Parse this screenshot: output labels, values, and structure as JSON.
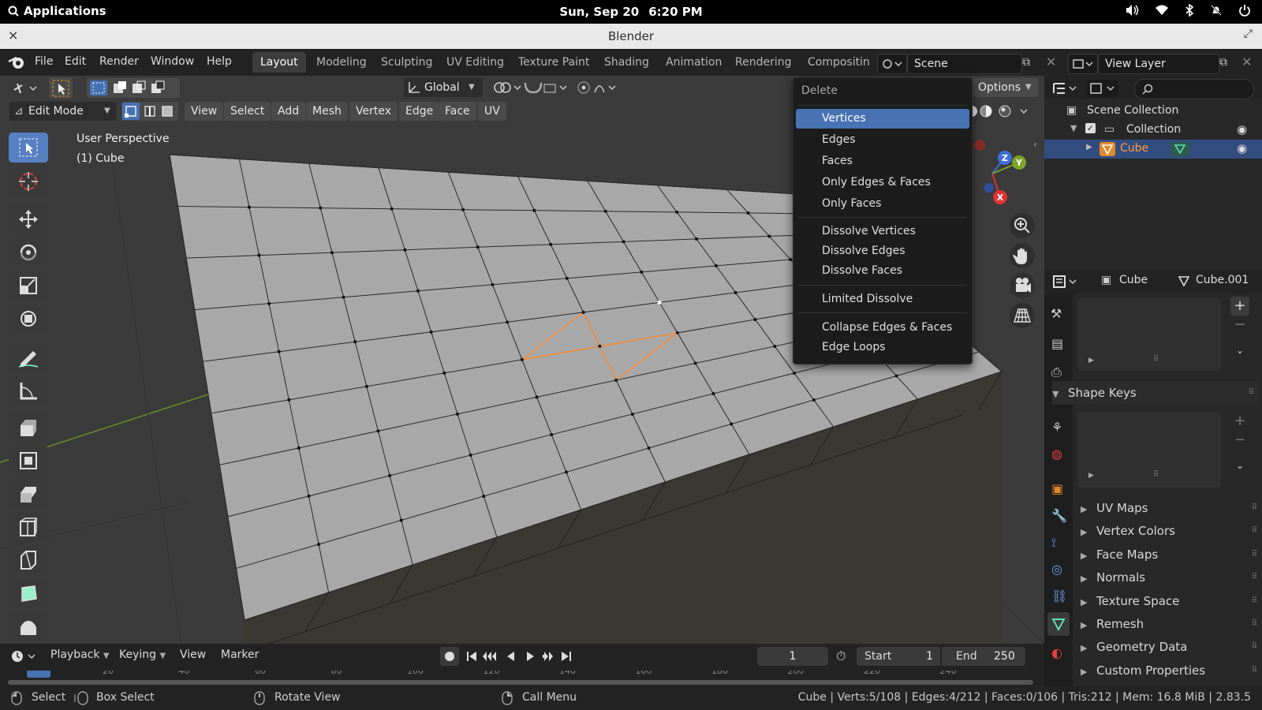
{
  "topbar": {
    "applications": "Applications",
    "date": "Sun, Sep 20",
    "time": "6:20 PM"
  },
  "window": {
    "title": "Blender",
    "close": "×"
  },
  "menubar": {
    "menus": [
      "File",
      "Edit",
      "Render",
      "Window",
      "Help"
    ],
    "workspaces": [
      "Layout",
      "Modeling",
      "Sculpting",
      "UV Editing",
      "Texture Paint",
      "Shading",
      "Animation",
      "Rendering",
      "Compositin"
    ],
    "scene": "Scene",
    "view_layer": "View Layer"
  },
  "viewport": {
    "transform_orientation": "Global",
    "mode": "Edit Mode",
    "header_menus": [
      "View",
      "Select",
      "Add",
      "Mesh",
      "Vertex",
      "Edge",
      "Face",
      "UV"
    ],
    "options": "Options",
    "overlay_line1": "User Perspective",
    "overlay_line2": "(1) Cube",
    "axis_x": "X",
    "axis_y": "Y",
    "axis_z": "Z"
  },
  "delete_menu": {
    "header": "Delete",
    "items": [
      "Vertices",
      "Edges",
      "Faces",
      "Only Edges & Faces",
      "Only Faces",
      "Dissolve Vertices",
      "Dissolve Edges",
      "Dissolve Faces",
      "Limited Dissolve",
      "Collapse Edges & Faces",
      "Edge Loops"
    ],
    "highlighted": "Vertices"
  },
  "outliner": {
    "scene_collection": "Scene Collection",
    "collection": "Collection",
    "cube": "Cube"
  },
  "properties": {
    "object": "Cube",
    "mesh_data": "Cube.001",
    "shape_keys": "Shape Keys",
    "sections": [
      "UV Maps",
      "Vertex Colors",
      "Face Maps",
      "Normals",
      "Texture Space",
      "Remesh",
      "Geometry Data",
      "Custom Properties"
    ]
  },
  "timeline": {
    "menus": [
      "Playback",
      "Keying",
      "View",
      "Marker"
    ],
    "current_frame": "1",
    "start_label": "Start",
    "start_value": "1",
    "end_label": "End",
    "end_value": "250",
    "ruler": [
      "20",
      "40",
      "60",
      "80",
      "100",
      "120",
      "140",
      "160",
      "180",
      "200",
      "220",
      "240"
    ]
  },
  "statusbar": {
    "select": "Select",
    "box_select": "Box Select",
    "rotate_view": "Rotate View",
    "call_menu": "Call Menu",
    "stats": "Cube | Verts:5/108 | Edges:4/212 | Faces:0/106 | Tris:212 | Mem: 16.8 MiB | 2.83.5"
  },
  "colors": {
    "accent": "#4772b3",
    "selected_edge": "#ff8a2b",
    "header_bg": "#232323",
    "viewport_bg": "#3b3b3b"
  }
}
